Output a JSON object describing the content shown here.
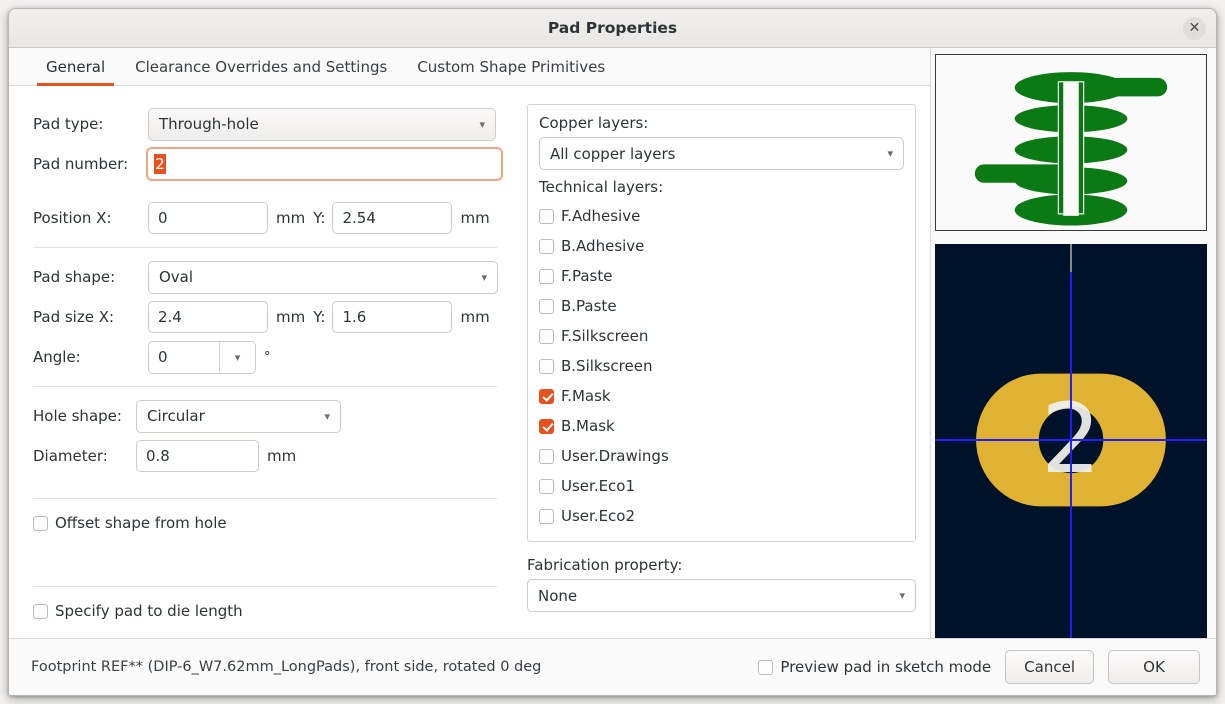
{
  "window": {
    "title": "Pad Properties",
    "close_icon": "close-icon"
  },
  "tabs": [
    {
      "label": "General",
      "active": true
    },
    {
      "label": "Clearance Overrides and Settings",
      "active": false
    },
    {
      "label": "Custom Shape Primitives",
      "active": false
    }
  ],
  "general": {
    "pad_type": {
      "label": "Pad type:",
      "value": "Through-hole"
    },
    "pad_number": {
      "label": "Pad number:",
      "value": "2"
    },
    "position": {
      "label_x": "Position X:",
      "value_x": "0",
      "unit_x": "mm",
      "label_y": "Y:",
      "value_y": "2.54",
      "unit_y": "mm"
    },
    "pad_shape": {
      "label": "Pad shape:",
      "value": "Oval"
    },
    "pad_size": {
      "label_x": "Pad size X:",
      "value_x": "2.4",
      "unit_x": "mm",
      "label_y": "Y:",
      "value_y": "1.6",
      "unit_y": "mm"
    },
    "angle": {
      "label": "Angle:",
      "value": "0",
      "unit": "°"
    },
    "hole_shape": {
      "label": "Hole shape:",
      "value": "Circular"
    },
    "diameter": {
      "label": "Diameter:",
      "value": "0.8",
      "unit": "mm"
    },
    "offset_shape": {
      "label": "Offset shape from hole",
      "checked": false
    },
    "pad_to_die": {
      "label": "Specify pad to die length",
      "checked": false
    }
  },
  "layers": {
    "copper_label": "Copper layers:",
    "copper_value": "All copper layers",
    "technical_label": "Technical layers:",
    "technical_items": [
      {
        "label": "F.Adhesive",
        "checked": false
      },
      {
        "label": "B.Adhesive",
        "checked": false
      },
      {
        "label": "F.Paste",
        "checked": false
      },
      {
        "label": "B.Paste",
        "checked": false
      },
      {
        "label": "F.Silkscreen",
        "checked": false
      },
      {
        "label": "B.Silkscreen",
        "checked": false
      },
      {
        "label": "F.Mask",
        "checked": true
      },
      {
        "label": "B.Mask",
        "checked": true
      },
      {
        "label": "User.Drawings",
        "checked": false
      },
      {
        "label": "User.Eco1",
        "checked": false
      },
      {
        "label": "User.Eco2",
        "checked": false
      }
    ],
    "fabrication_label": "Fabrication property:",
    "fabrication_value": "None"
  },
  "preview": {
    "stack_color": "#0b7a15",
    "pad_color": "#e0b232",
    "canvas_color": "#00112a",
    "crosshair_color": "#1f1fff",
    "pad_label": "2"
  },
  "footer": {
    "status": "Footprint REF** (DIP-6_W7.62mm_LongPads), front side, rotated 0 deg",
    "sketch_mode": {
      "label": "Preview pad in sketch mode",
      "checked": false
    },
    "cancel_label": "Cancel",
    "ok_label": "OK"
  }
}
